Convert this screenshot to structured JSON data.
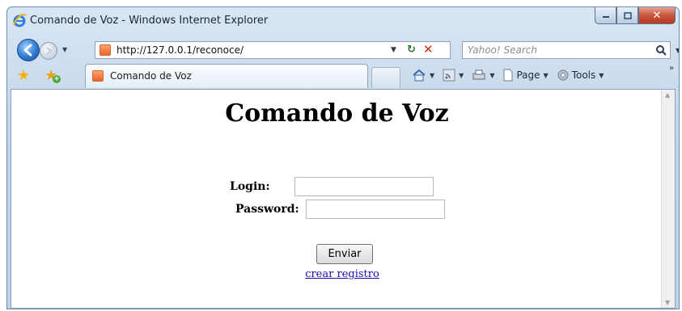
{
  "window": {
    "title": "Comando de Voz - Windows Internet Explorer"
  },
  "address_bar": {
    "url": "http://127.0.0.1/reconoce/"
  },
  "search": {
    "placeholder": "Yahoo! Search"
  },
  "tab": {
    "label": "Comando de Voz"
  },
  "command_bar": {
    "page_label": "Page",
    "tools_label": "Tools"
  },
  "page": {
    "heading": "Comando de Voz",
    "login_label": "Login:",
    "login_value": "",
    "password_label": "Password:",
    "password_value": "",
    "submit_label": "Enviar",
    "register_link": "crear registro"
  },
  "colors": {
    "link": "#1a0dab",
    "close_button": "#c8553a"
  }
}
